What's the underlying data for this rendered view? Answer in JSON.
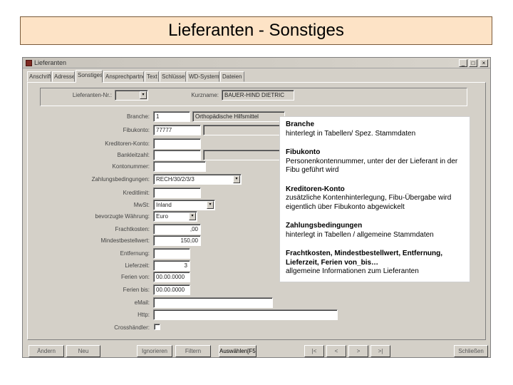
{
  "slide_title": "Lieferanten - Sonstiges",
  "window": {
    "title": "Lieferanten",
    "controls": [
      "_",
      "□",
      "×"
    ]
  },
  "tabs": [
    "Anschrift",
    "Adresse",
    "Sonstiges",
    "Ansprechpartner",
    "Text",
    "Schlüssel",
    "WD-Systeme",
    "Dateien"
  ],
  "header": {
    "supplier_no_label": "Lieferanten-Nr.:",
    "supplier_no_value": "",
    "short_name_label": "Kurzname:",
    "short_name_value": "BAUER-HIND DIETRIC"
  },
  "fields": {
    "branche_label": "Branche:",
    "branche_value": "1",
    "branche_desc": "Orthopädische Hilfsmittel",
    "fibukonto_label": "Fibukonto:",
    "fibukonto_value": "77777",
    "kreditoren_label": "Kreditoren-Konto:",
    "kreditoren_value": "",
    "bankleitzahl_label": "Bankleitzahl:",
    "bankleitzahl_value": "",
    "kontonummer_label": "Kontonummer:",
    "kontonummer_value": "",
    "zahlung_label": "Zahlungsbedingungen:",
    "zahlung_value": "RECH/30/2/3/3",
    "kreditlimit_label": "Kreditlimit:",
    "kreditlimit_value": "",
    "mwst_label": "MwSt:",
    "mwst_value": "Inland",
    "waehrung_label": "bevorzugte Währung:",
    "waehrung_value": "Euro",
    "fracht_label": "Frachtkosten:",
    "fracht_value": ",00",
    "mindest_label": "Mindestbestellwert:",
    "mindest_value": "150,00",
    "entfernung_label": "Entfernung:",
    "entfernung_value": "",
    "lieferzeit_label": "Lieferzeit:",
    "lieferzeit_value": "3",
    "ferien_von_label": "Ferien von:",
    "ferien_von_value": "00.00.0000",
    "ferien_bis_label": "Ferien bis:",
    "ferien_bis_value": "00.00.0000",
    "email_label": "eMail:",
    "email_value": "",
    "http_label": "Http:",
    "http_value": "",
    "crosshaendler_label": "Crosshändler:"
  },
  "buttons": [
    "Ändern",
    "Neu",
    "Ignorieren",
    "Filtern",
    "Auswählen[F5]",
    "|<",
    "<",
    ">",
    ">|",
    "Schließen"
  ],
  "popup": [
    {
      "heading": "Branche",
      "text": "hinterlegt in Tabellen/ Spez. Stammdaten"
    },
    {
      "heading": "Fibukonto",
      "text": "Personenkontennummer, unter der der Lieferant in der Fibu geführt wird"
    },
    {
      "heading": "Kreditoren-Konto",
      "text": "zusätzliche Kontenhinterlegung, Fibu-Übergabe wird eigentlich über Fibukonto abgewickelt"
    },
    {
      "heading": "Zahlungsbedingungen",
      "text": "hinterlegt in Tabellen / allgemeine Stammdaten"
    },
    {
      "heading": "Frachtkosten, Mindestbestellwert, Entfernung, Lieferzeit, Ferien von_bis…",
      "text": "allgemeine Informationen zum Lieferanten"
    }
  ]
}
